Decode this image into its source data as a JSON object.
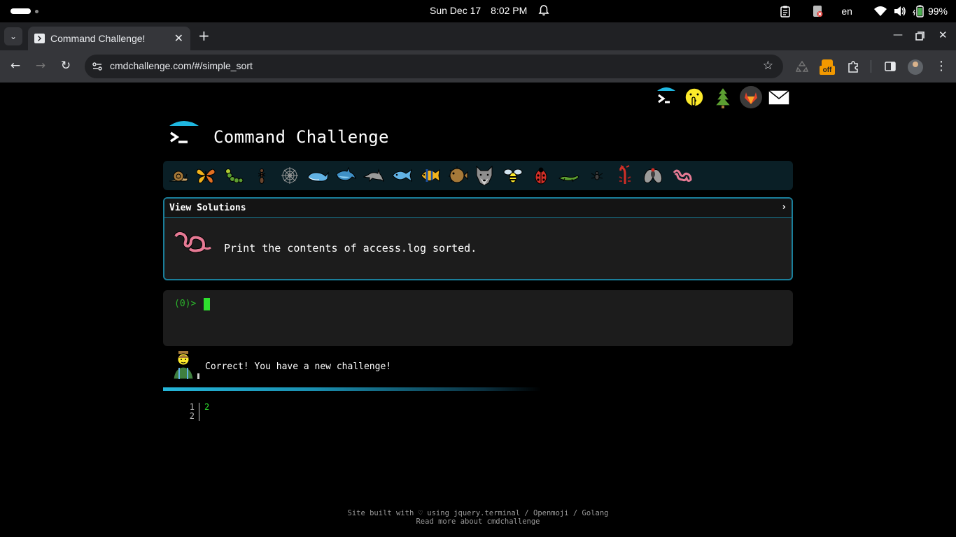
{
  "os": {
    "date": "Sun Dec 17",
    "time": "8:02 PM",
    "language": "en",
    "battery": "99%"
  },
  "browser": {
    "tab_title": "Command Challenge!",
    "url": "cmdchallenge.com/#/simple_sort",
    "extension_badge": "off"
  },
  "site": {
    "title": "Command Challenge",
    "social_icons": [
      "terminal-icon",
      "shushing-face-icon",
      "tree-icon",
      "gitlab-icon",
      "envelope-icon"
    ],
    "animal_icons": [
      "snail-icon",
      "butterfly-icon",
      "caterpillar-icon",
      "ant-icon",
      "spider-web-icon",
      "whale-icon",
      "shark-icon",
      "dolphin-icon",
      "fish-icon",
      "tropical-fish-icon",
      "pufferfish-icon",
      "wolf-icon",
      "bee-icon",
      "ladybug-icon",
      "lizard-icon",
      "spider-icon",
      "scorpion-icon",
      "fly-icon",
      "worm-icon"
    ]
  },
  "challenge": {
    "solutions_label": "View Solutions",
    "chevron": "›",
    "description": "Print the contents of access.log sorted."
  },
  "terminal": {
    "prompt": "(0)>"
  },
  "feedback": {
    "message": "Correct! You have a new challenge!"
  },
  "output": {
    "line_numbers": [
      "1",
      "2"
    ],
    "values": [
      "2"
    ]
  },
  "footer": {
    "line1": "Site built with ♡ using jquery.terminal / Openmoji / Golang",
    "line2": "Read more about cmdchallenge"
  },
  "colors": {
    "accent": "#1a7e9a",
    "prompt_green": "#2bb52b",
    "progress": "#25b6d9"
  }
}
